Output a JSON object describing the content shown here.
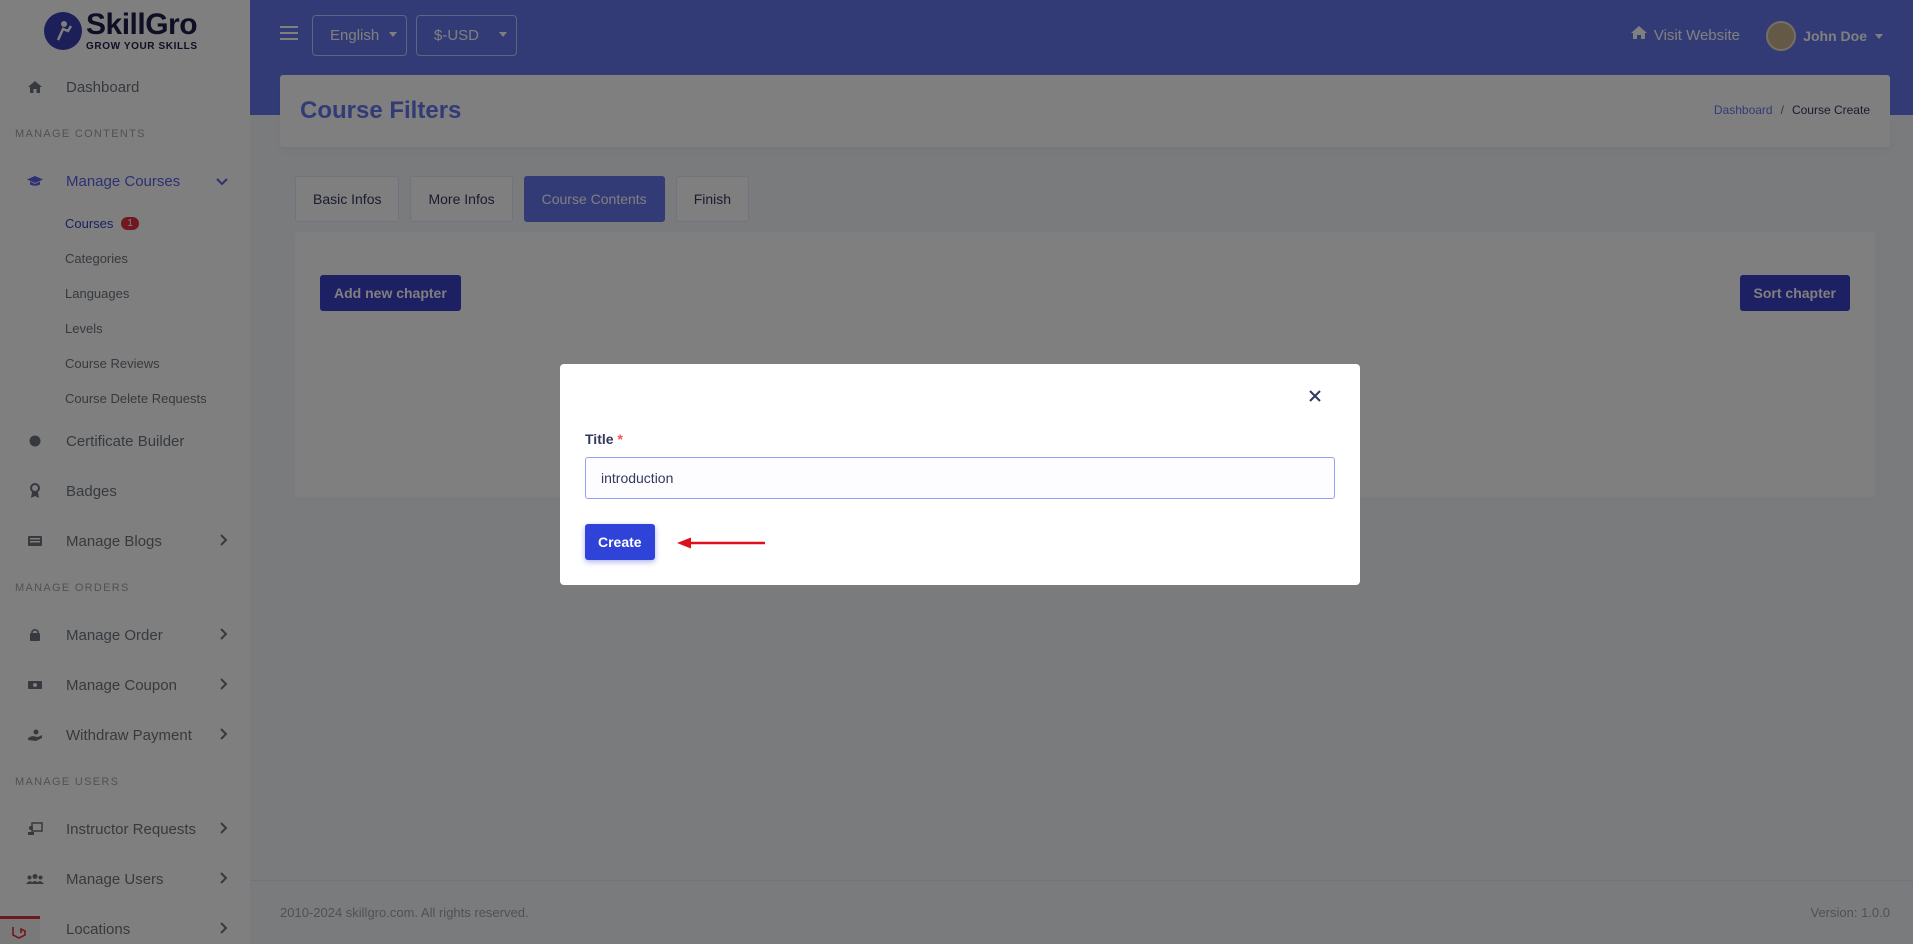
{
  "brand": {
    "name": "SkillGro",
    "tagline": "GROW YOUR SKILLS",
    "logo_icon": "graduate-figure-icon"
  },
  "sidebar": {
    "dashboard": "Dashboard",
    "sections": {
      "manage_contents": "MANAGE CONTENTS",
      "manage_orders": "MANAGE ORDERS",
      "manage_users": "MANAGE USERS"
    },
    "manage_courses": "Manage Courses",
    "sub_items": {
      "courses": "Courses",
      "courses_badge": "1",
      "categories": "Categories",
      "languages": "Languages",
      "levels": "Levels",
      "course_reviews": "Course Reviews",
      "course_delete_requests": "Course Delete Requests"
    },
    "certificate_builder": "Certificate Builder",
    "badges": "Badges",
    "manage_blogs": "Manage Blogs",
    "manage_order": "Manage Order",
    "manage_coupon": "Manage Coupon",
    "withdraw_payment": "Withdraw Payment",
    "instructor_requests": "Instructor Requests",
    "manage_users": "Manage Users",
    "locations": "Locations"
  },
  "topbar": {
    "language": "English",
    "currency": "$-USD",
    "visit_website": "Visit Website",
    "user_name": "John Doe"
  },
  "header": {
    "title": "Course Filters",
    "breadcrumb": {
      "home": "Dashboard",
      "separator": "/",
      "current": "Course Create"
    }
  },
  "tabs": {
    "basic_infos": "Basic Infos",
    "more_infos": "More Infos",
    "course_contents": "Course Contents",
    "finish": "Finish"
  },
  "card": {
    "add_chapter": "Add new chapter",
    "sort_chapter": "Sort chapter"
  },
  "modal": {
    "title_label": "Title",
    "required_mark": "*",
    "title_value": "introduction",
    "create_button": "Create",
    "close_symbol": "×"
  },
  "footer": {
    "copyright": "2010-2024 skillgro.com. All rights reserved.",
    "version": "Version: 1.0.0"
  },
  "colors": {
    "primary": "#6777ef",
    "dark_button": "#3b40c4",
    "create_button": "#2f43d8",
    "badge": "#e0313e",
    "annotation_arrow": "#e0101a"
  }
}
